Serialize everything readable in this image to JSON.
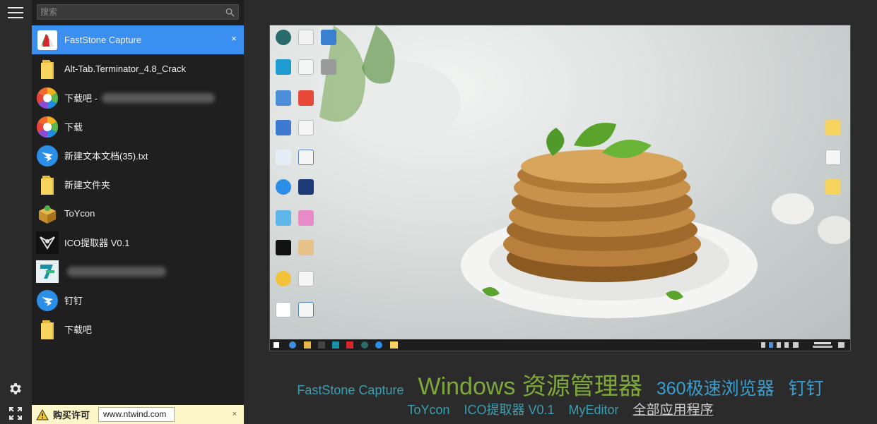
{
  "search": {
    "placeholder": "搜索"
  },
  "windows": [
    {
      "label": "FastStone Capture",
      "icon": "faststone-icon",
      "active": true,
      "close": "×"
    },
    {
      "label": "Alt-Tab.Terminator_4.8_Crack",
      "icon": "folder-icon"
    },
    {
      "label": "下载吧 - ",
      "icon": "browser-360-icon",
      "blurred": true
    },
    {
      "label": "下载",
      "icon": "browser-360-icon"
    },
    {
      "label": "新建文本文档(35).txt",
      "icon": "dingtalk-icon"
    },
    {
      "label": "新建文件夹",
      "icon": "folder-icon"
    },
    {
      "label": "ToYcon",
      "icon": "toycon-icon"
    },
    {
      "label": "ICO提取器 V0.1",
      "icon": "ico-extractor-icon"
    },
    {
      "label": "",
      "icon": "myeditor-icon",
      "blurred": true
    },
    {
      "label": "钉钉",
      "icon": "dingtalk-icon"
    },
    {
      "label": "下载吧",
      "icon": "folder-icon"
    }
  ],
  "license": {
    "buy_label": "购买许可",
    "url": "www.ntwind.com",
    "close": "×"
  },
  "titles": {
    "faststone": "FastStone Capture",
    "explorer": "Windows 资源管理器",
    "browser": "360极速浏览器",
    "dingtalk": "钉钉",
    "toycon": "ToYcon",
    "ico": "ICO提取器 V0.1",
    "myeditor": "MyEditor",
    "all_apps": "全部应用程序"
  }
}
